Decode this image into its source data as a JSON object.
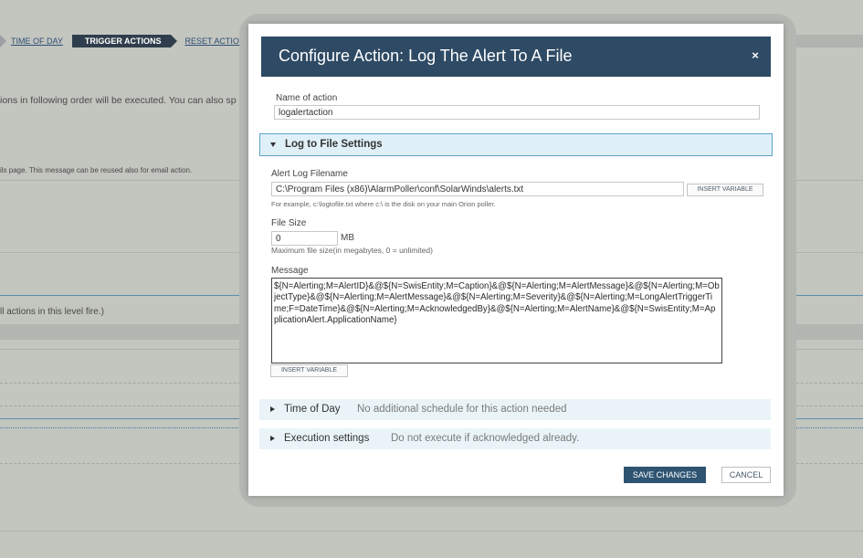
{
  "background": {
    "breadcrumbs": [
      {
        "label": "TIME OF DAY",
        "active": false
      },
      {
        "label": "TRIGGER ACTIONS",
        "active": true
      },
      {
        "label": "RESET ACTIONS",
        "active": false
      }
    ],
    "text_order": "ions in following order will be executed. You can also sp",
    "text_message": "ils page. This message can be reused also for email action.",
    "text_level": "ll actions in this level fire.)"
  },
  "modal": {
    "title": "Configure Action: Log The Alert To A File",
    "close_glyph": "×",
    "name_label": "Name of action",
    "name_value": "logalertaction",
    "section_title": "Log to File Settings",
    "filename_label": "Alert Log Filename",
    "filename_value": "C:\\Program Files (x86)\\AlarmPoller\\conf\\SolarWinds\\alerts.txt",
    "insert_variable_label": "INSERT VARIABLE",
    "filename_hint": "For example, c:\\logtofile.txt where c:\\ is the disk on your main Orion poller.",
    "filesize_label": "File Size",
    "filesize_value": "0",
    "filesize_unit": "MB",
    "filesize_hint": "Maximum file size(in megabytes, 0 = unlimited)",
    "message_label": "Message",
    "message_value": "${N=Alerting;M=AlertID}&@${N=SwisEntity;M=Caption}&@${N=Alerting;M=AlertMessage}&@${N=Alerting;M=ObjectType}&@${N=Alerting;M=AlertMessage}&@${N=Alerting;M=Severity}&@${N=Alerting;M=LongAlertTriggerTime;F=DateTime}&@${N=Alerting;M=AcknowledgedBy}&@${N=Alerting;M=AlertName}&@${N=SwisEntity;M=ApplicationAlert.ApplicationName}",
    "message_insert_variable_label": "INSERT VARIABLE",
    "time_of_day": {
      "title": "Time of Day",
      "desc": "No additional schedule for this action needed"
    },
    "execution_settings": {
      "title": "Execution settings",
      "desc": "Do not execute if acknowledged already."
    },
    "save_label": "SAVE CHANGES",
    "cancel_label": "CANCEL"
  },
  "colors": {
    "header_bg": "#2e4a64",
    "section_border": "#5ba3cc",
    "save_bg": "#2e5472",
    "overlay_bg": "#c3c5bf"
  }
}
